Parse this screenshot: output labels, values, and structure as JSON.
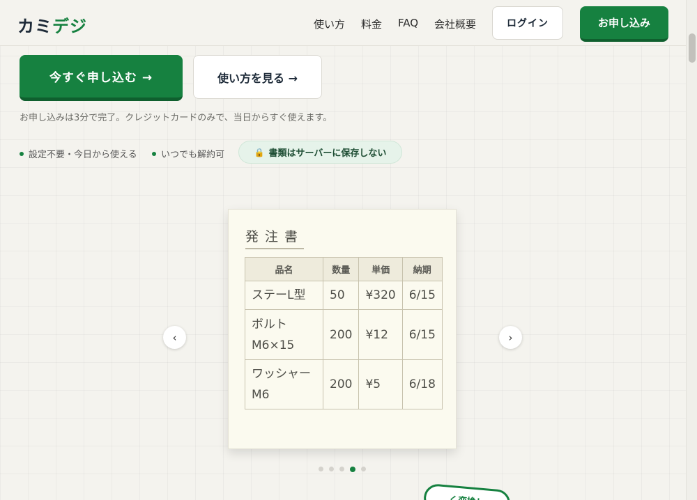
{
  "brand": {
    "part1": "カミ",
    "part2": "デジ",
    "accent": "#168140",
    "dark": "#1d2a38"
  },
  "nav": {
    "items": [
      "使い方",
      "料金",
      "FAQ",
      "会社概要"
    ],
    "login": "ログイン",
    "apply": "お申し込み"
  },
  "hero": {
    "primary_cta": "今すぐ申し込む →",
    "secondary_cta": "使い方を見る →",
    "note": "お申し込みは3分で完了。クレジットカードのみで、当日からすぐ使えます。",
    "features": [
      "設定不要・今日から使える",
      "いつでも解約可"
    ],
    "badge_icon": "lock-icon",
    "badge": "書類はサーバーに保存しない"
  },
  "slide": {
    "doc_title": "発注書",
    "headers": [
      "品名",
      "数量",
      "単価",
      "納期"
    ],
    "rows": [
      [
        "ステーL型",
        "50",
        "¥320",
        "6/15"
      ],
      [
        "ボルトM6×15",
        "200",
        "¥12",
        "6/15"
      ],
      [
        "ワッシャーM6",
        "200",
        "¥5",
        "6/18"
      ]
    ],
    "prev": "‹",
    "next": "›",
    "active_index": 3,
    "count": 5
  },
  "stamp": {
    "text": "く変換！"
  }
}
